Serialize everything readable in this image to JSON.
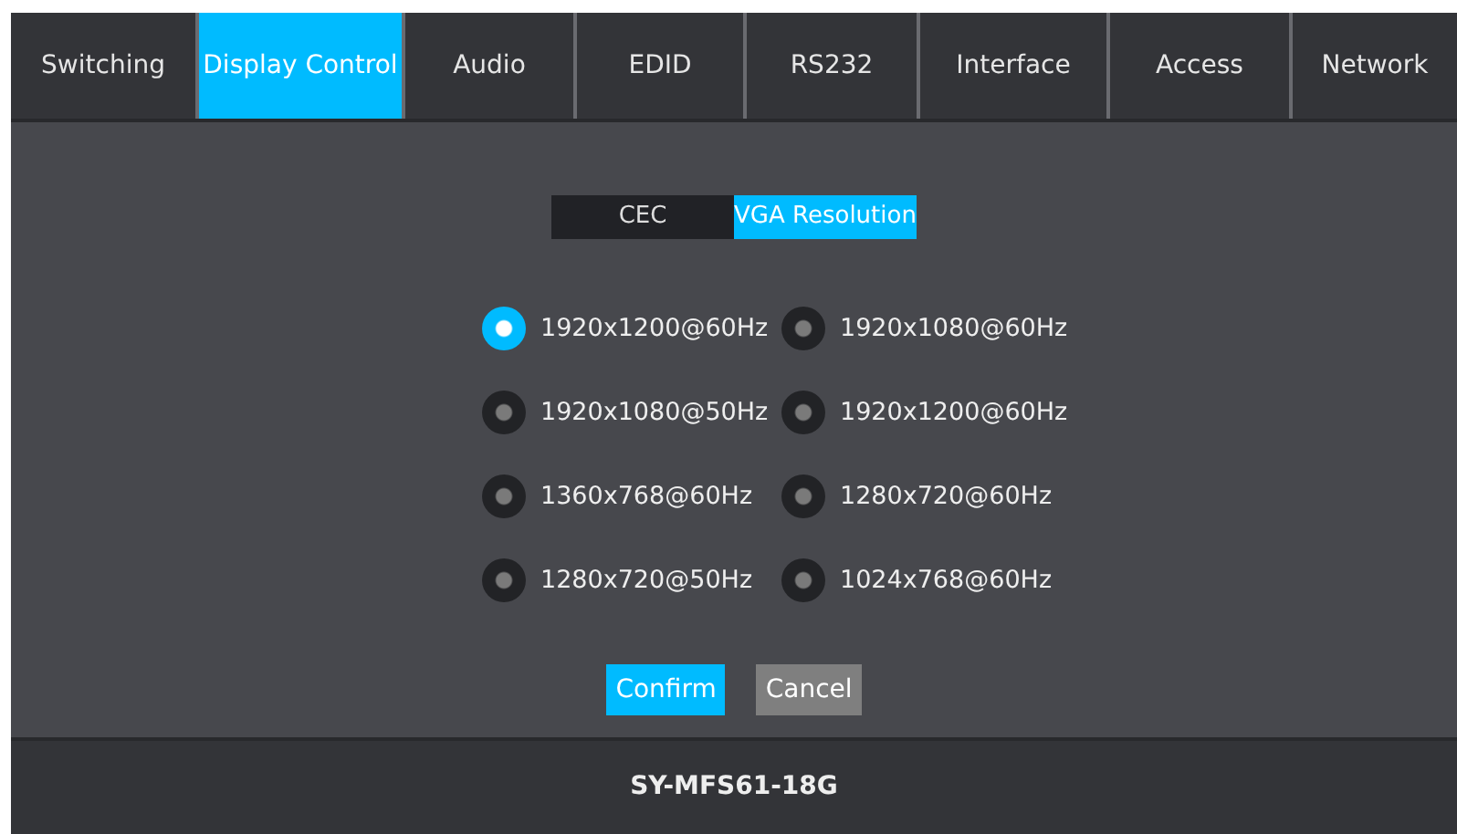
{
  "tabs": [
    {
      "label": "Switching",
      "selected": false
    },
    {
      "label": "Display Control",
      "selected": true
    },
    {
      "label": "Audio",
      "selected": false
    },
    {
      "label": "EDID",
      "selected": false
    },
    {
      "label": "RS232",
      "selected": false
    },
    {
      "label": "Interface",
      "selected": false
    },
    {
      "label": "Access",
      "selected": false
    },
    {
      "label": "Network",
      "selected": false
    }
  ],
  "subtabs": [
    {
      "label": "CEC",
      "selected": false
    },
    {
      "label": "VGA Resolution",
      "selected": true
    }
  ],
  "resolutions": [
    {
      "label": "1920x1200@60Hz",
      "selected": true
    },
    {
      "label": "1920x1080@60Hz",
      "selected": false
    },
    {
      "label": "1920x1080@50Hz",
      "selected": false
    },
    {
      "label": "1920x1200@60Hz",
      "selected": false
    },
    {
      "label": "1360x768@60Hz",
      "selected": false
    },
    {
      "label": "1280x720@60Hz",
      "selected": false
    },
    {
      "label": "1280x720@50Hz",
      "selected": false
    },
    {
      "label": "1024x768@60Hz",
      "selected": false
    }
  ],
  "buttons": [
    {
      "label": "Confirm",
      "kind": "primary"
    },
    {
      "label": "Cancel",
      "kind": "secondary"
    }
  ],
  "footer": "SY-MFS61-18G"
}
